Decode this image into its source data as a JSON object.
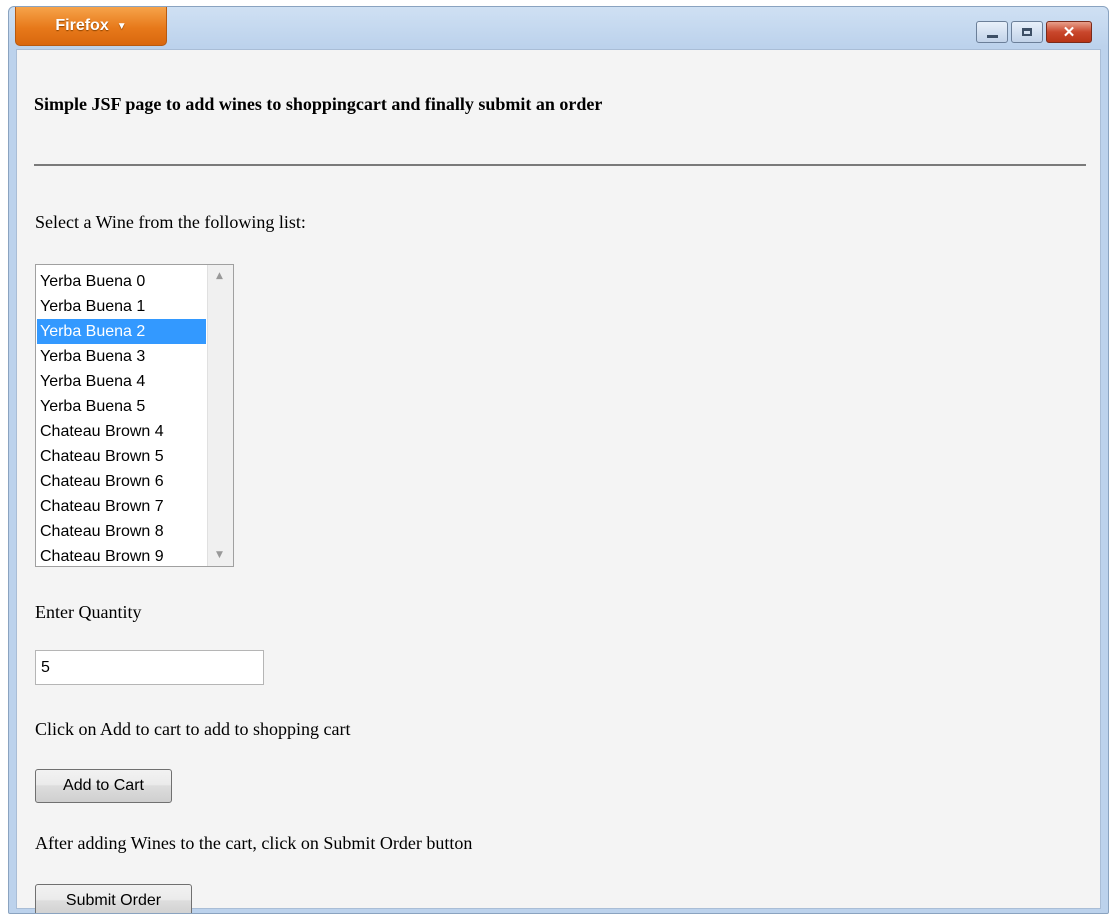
{
  "browser": {
    "menu_button_label": "Firefox",
    "menu_caret": "▼",
    "controls": {
      "minimize_icon": "minimize-icon",
      "maximize_icon": "maximize-icon",
      "close_glyph": "✕"
    }
  },
  "page": {
    "heading": "Simple JSF page to add wines to shoppingcart and finally submit an order",
    "select_label": "Select a Wine from the following list:",
    "wine_list": {
      "options": [
        "Yerba Buena 0",
        "Yerba Buena 1",
        "Yerba Buena 2",
        "Yerba Buena 3",
        "Yerba Buena 4",
        "Yerba Buena 5",
        "Chateau Brown 4",
        "Chateau Brown 5",
        "Chateau Brown 6",
        "Chateau Brown 7",
        "Chateau Brown 8",
        "Chateau Brown 9"
      ],
      "selected": "Yerba Buena 2"
    },
    "quantity_label": "Enter Quantity",
    "quantity_value": "5",
    "add_instruction": "Click on Add to cart to add to shopping cart",
    "add_button_label": "Add to Cart",
    "submit_instruction": "After adding Wines to the cart, click on Submit Order button",
    "submit_button_label": "Submit Order"
  },
  "colors": {
    "firefox_button": "#e7791a",
    "selection": "#3399ff",
    "close_button": "#c9472c"
  }
}
